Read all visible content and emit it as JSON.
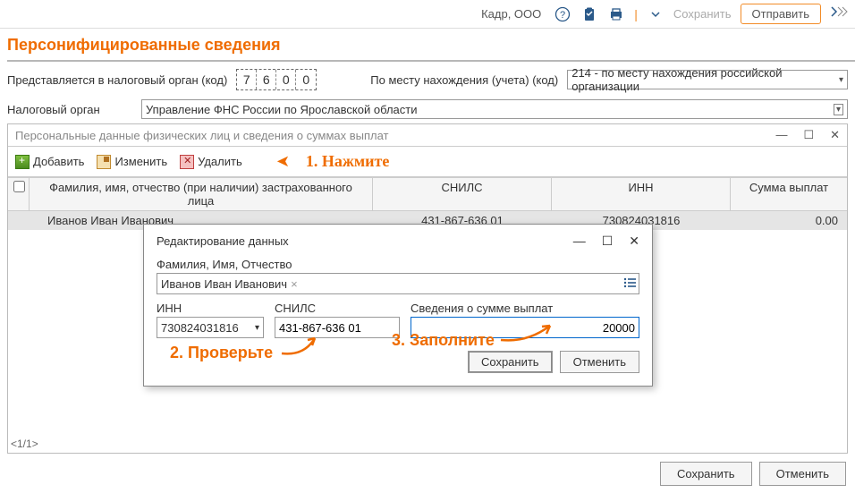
{
  "topbar": {
    "company": "Кадр, ООО",
    "save_label": "Сохранить",
    "send_label": "Отправить"
  },
  "page_title": "Персонифицированные сведения",
  "row_tax": {
    "label": "Представляется в налоговый орган (код)",
    "digits": [
      "7",
      "6",
      "0",
      "0"
    ],
    "place_label": "По месту нахождения (учета) (код)",
    "place_value": "214 - по месту нахождения российской организации"
  },
  "row_org": {
    "label": "Налоговый орган",
    "value": "Управление ФНС России по Ярославской области"
  },
  "subwindow": {
    "title": "Персональные данные физических лиц и сведения о суммах выплат",
    "toolbar": {
      "add": "Добавить",
      "edit": "Изменить",
      "del": "Удалить"
    },
    "annotation1": "1. Нажмите",
    "table_head": {
      "name": "Фамилия, имя, отчество (при наличии) застрахованного лица",
      "snils": "СНИЛС",
      "inn": "ИНН",
      "sum": "Сумма выплат"
    },
    "rows": [
      {
        "name": "Иванов Иван Иванович",
        "snils": "431-867-636 01",
        "inn": "730824031816",
        "sum": "0.00"
      }
    ]
  },
  "dialog": {
    "title": "Редактирование данных",
    "fio_label": "Фамилия, Имя, Отчество",
    "fio_value": "Иванов Иван Иванович",
    "inn_label": "ИНН",
    "inn_value": "730824031816",
    "snils_label": "СНИЛС",
    "snils_value": "431-867-636 01",
    "sum_label": "Сведения о сумме выплат",
    "sum_value": "20000",
    "save": "Сохранить",
    "cancel": "Отменить"
  },
  "annotation2": "2. Проверьте",
  "annotation3": "3. Заполните",
  "pager": "<1/1>",
  "bottom": {
    "save": "Сохранить",
    "cancel": "Отменить"
  }
}
